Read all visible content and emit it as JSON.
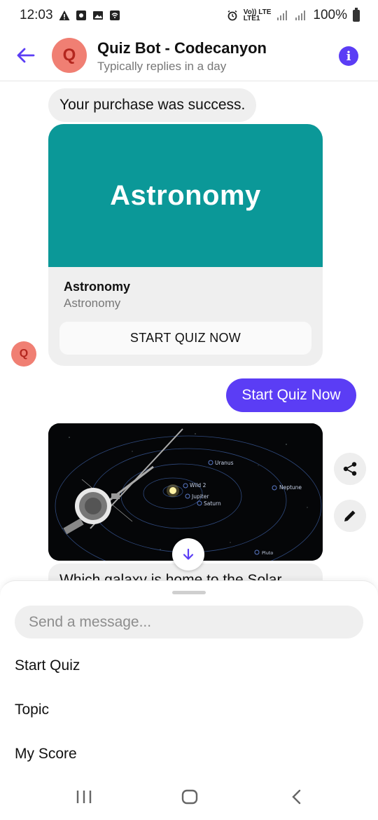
{
  "status_bar": {
    "time": "12:03",
    "network_label": "Vo)) LTE",
    "network_sub": "LTE1",
    "battery": "100%"
  },
  "header": {
    "avatar_letter": "Q",
    "title": "Quiz Bot - Codecanyon",
    "subtitle": "Typically replies in a day",
    "info_icon": "i"
  },
  "chat": {
    "purchase_message": "Your purchase was success.",
    "card": {
      "banner_text": "Astronomy",
      "banner_color": "#0b9898",
      "title": "Astronomy",
      "subtitle": "Astronomy",
      "button_label": "START QUIZ NOW"
    },
    "bot_avatar_letter": "Q",
    "user_message": "Start Quiz Now",
    "image_labels": {
      "uranus": "Uranus",
      "wild2": "Wild 2",
      "jupiter": "Jupiter",
      "saturn": "Saturn",
      "neptune": "Neptune",
      "pluto": "Pluto"
    },
    "question_partial": "Which galaxy is home to the Solar"
  },
  "composer": {
    "placeholder": "Send a message..."
  },
  "quick_menu": {
    "items": [
      "Start Quiz",
      "Topic",
      "My Score"
    ]
  },
  "colors": {
    "accent": "#5b3df5",
    "avatar": "#f07f73",
    "bubble_gray": "#efefef"
  }
}
